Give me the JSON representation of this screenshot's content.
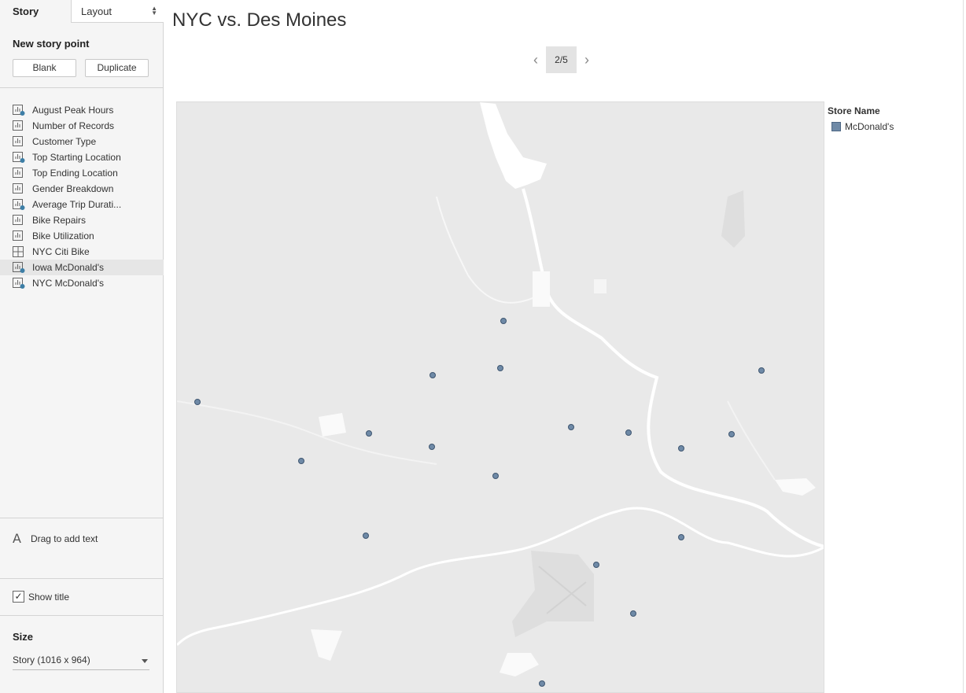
{
  "sidebar": {
    "tab_story": "Story",
    "tab_layout": "Layout",
    "new_story_point_title": "New story point",
    "blank_label": "Blank",
    "duplicate_label": "Duplicate",
    "sheets": [
      {
        "label": "August Peak Hours",
        "icon": "bar-chart-check-icon"
      },
      {
        "label": "Number of Records",
        "icon": "bar-chart-icon"
      },
      {
        "label": "Customer Type",
        "icon": "bar-chart-icon"
      },
      {
        "label": "Top Starting Location",
        "icon": "bar-chart-check-icon"
      },
      {
        "label": "Top Ending Location",
        "icon": "bar-chart-icon"
      },
      {
        "label": "Gender Breakdown",
        "icon": "bar-chart-icon"
      },
      {
        "label": "Average Trip Durati...",
        "icon": "bar-chart-check-icon"
      },
      {
        "label": "Bike Repairs",
        "icon": "bar-chart-icon"
      },
      {
        "label": "Bike Utilization",
        "icon": "bar-chart-icon"
      },
      {
        "label": "NYC Citi Bike",
        "icon": "dashboard-icon"
      },
      {
        "label": "Iowa McDonald's",
        "icon": "bar-chart-check-icon"
      },
      {
        "label": "NYC McDonald's",
        "icon": "bar-chart-check-icon"
      }
    ],
    "drag_text_label": "Drag to add text",
    "show_title_label": "Show title",
    "show_title_checked": "✓",
    "size_title": "Size",
    "size_value": "Story (1016 x 964)"
  },
  "main": {
    "story_title": "NYC vs. Des Moines",
    "page_indicator": "2/5",
    "legend_title": "Store Name",
    "legend_item": "McDonald's",
    "marker_color": "#6f8aa7"
  }
}
